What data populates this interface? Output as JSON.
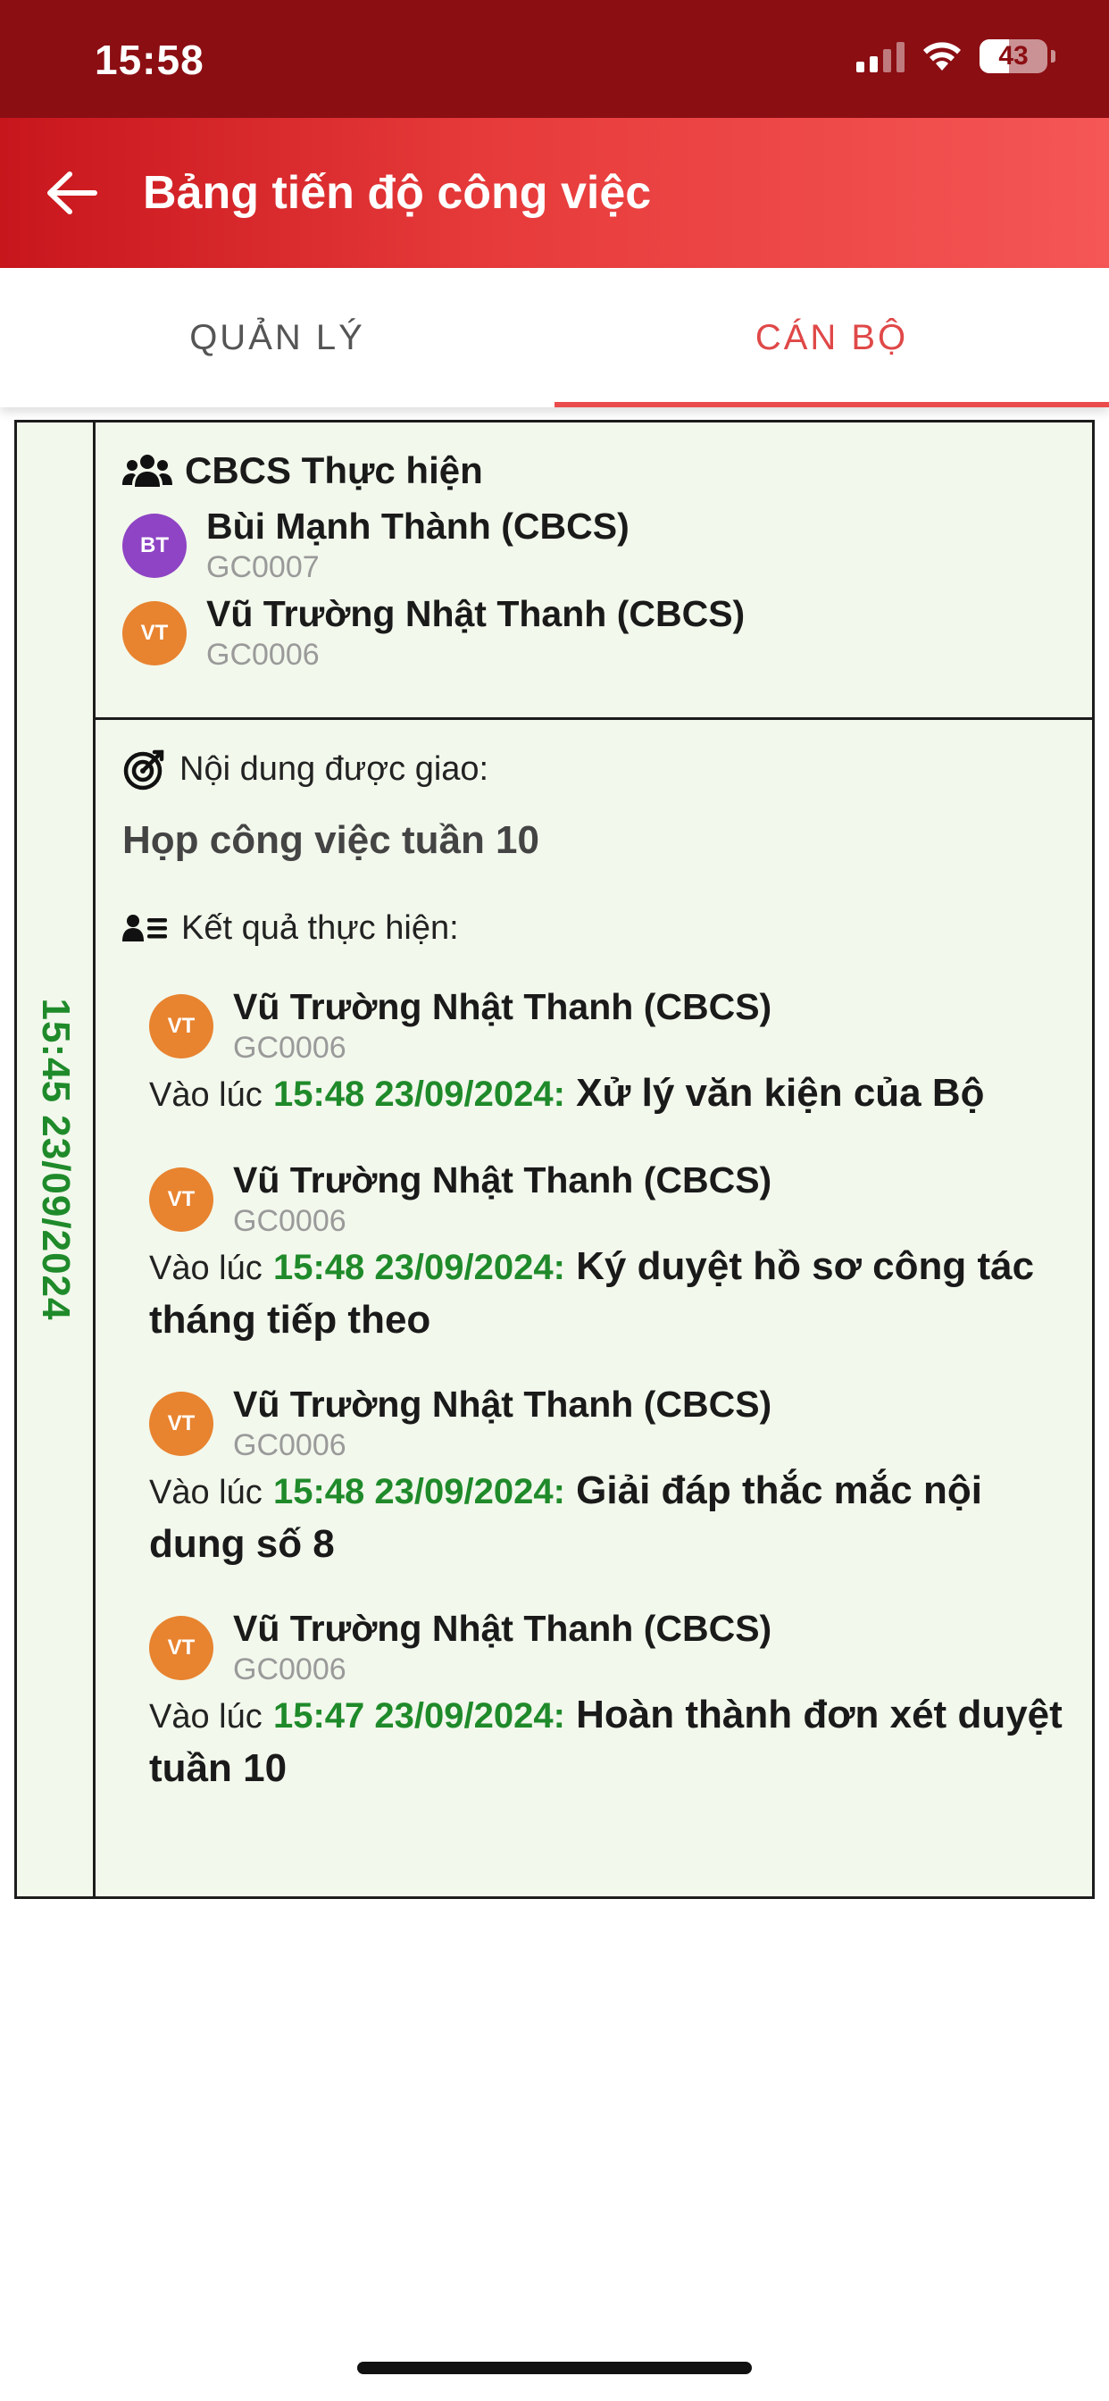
{
  "status_bar": {
    "time": "15:58",
    "battery": "43",
    "battery_level_percent": 43
  },
  "app_bar": {
    "title": "Bảng tiến độ công việc",
    "back_icon": "arrow-left-icon"
  },
  "tabs": [
    {
      "label": "QUẢN LÝ",
      "active": false
    },
    {
      "label": "CÁN BỘ",
      "active": true
    }
  ],
  "card": {
    "date": "15:45 23/09/2024",
    "assignees": {
      "heading": "CBCS Thực hiện",
      "icon": "users-icon",
      "people": [
        {
          "initials": "BT",
          "name": "Bùi Mạnh Thành (CBCS)",
          "code": "GC0007",
          "color": "#8e44c4"
        },
        {
          "initials": "VT",
          "name": "Vũ Trường Nhật Thanh (CBCS)",
          "code": "GC0006",
          "color": "#e8832f"
        }
      ]
    },
    "assigned": {
      "label": "Nội dung được giao:",
      "icon": "target-icon",
      "text": "Họp công việc tuần 10"
    },
    "results": {
      "label": "Kết quả thực hiện:",
      "icon": "user-list-icon",
      "items": [
        {
          "initials": "VT",
          "name": "Vũ Trường Nhật Thanh (CBCS)",
          "code": "GC0006",
          "prefix": "Vào lúc",
          "time": "15:48 23/09/2024:",
          "desc": "Xử lý văn kiện của Bộ"
        },
        {
          "initials": "VT",
          "name": "Vũ Trường Nhật Thanh (CBCS)",
          "code": "GC0006",
          "prefix": "Vào lúc",
          "time": "15:48 23/09/2024:",
          "desc": "Ký duyệt hồ sơ công tác tháng tiếp theo"
        },
        {
          "initials": "VT",
          "name": "Vũ Trường Nhật Thanh (CBCS)",
          "code": "GC0006",
          "prefix": "Vào lúc",
          "time": "15:48 23/09/2024:",
          "desc": "Giải đáp thắc mắc nội dung số 8"
        },
        {
          "initials": "VT",
          "name": "Vũ Trường Nhật Thanh (CBCS)",
          "code": "GC0006",
          "prefix": "Vào lúc",
          "time": "15:47 23/09/2024:",
          "desc": "Hoàn thành đơn xét duyệt tuần 10"
        }
      ]
    }
  },
  "colors": {
    "status_bar": "#8b0e13",
    "accent": "#e04848",
    "card_bg": "#f2f8ec",
    "time_green": "#1f8a2a"
  }
}
